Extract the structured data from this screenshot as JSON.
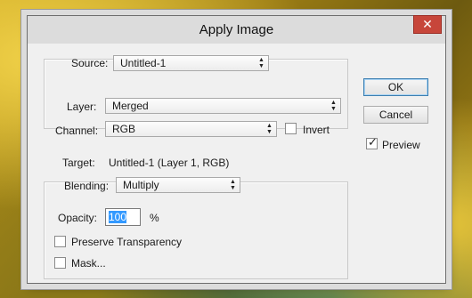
{
  "window": {
    "title": "Apply Image",
    "close_glyph": "✕"
  },
  "source": {
    "label": "Source:",
    "value": "Untitled-1",
    "layer_label": "Layer:",
    "layer_value": "Merged",
    "channel_label": "Channel:",
    "channel_value": "RGB",
    "invert_label": "Invert",
    "invert_checked": false
  },
  "target": {
    "label": "Target:",
    "value": "Untitled-1 (Layer 1, RGB)"
  },
  "blending": {
    "label": "Blending:",
    "value": "Multiply",
    "opacity_label": "Opacity:",
    "opacity_value": "100",
    "opacity_unit": "%",
    "preserve_label": "Preserve Transparency",
    "preserve_checked": false,
    "mask_label": "Mask...",
    "mask_checked": false
  },
  "buttons": {
    "ok": "OK",
    "cancel": "Cancel"
  },
  "preview": {
    "label": "Preview",
    "checked": true
  },
  "icons": {
    "dropdown": "updown-arrow-icon",
    "close": "close-icon"
  }
}
